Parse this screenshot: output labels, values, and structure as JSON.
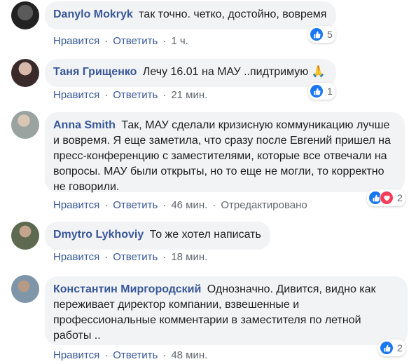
{
  "colors": {
    "link": "#385898",
    "bubble": "#f2f3f5",
    "meta": "#606770",
    "like": "#1877f2",
    "love": "#f33e58"
  },
  "comments": [
    {
      "author": "Danylo Mokryk",
      "text": "так точно. четко, достойно, вовремя",
      "like_label": "Нравится",
      "reply_label": "Ответить",
      "time": "1 ч.",
      "reactions": [
        "like-icon"
      ],
      "reaction_count": "5"
    },
    {
      "author": "Таня Грищенко",
      "text": "Лечу 16.01 на МАУ ..пидтримую 🙏",
      "like_label": "Нравится",
      "reply_label": "Ответить",
      "time": "21 мин.",
      "reactions": [
        "like-icon"
      ],
      "reaction_count": "1"
    },
    {
      "author": "Anna Smith",
      "text": "Так, МАУ сделали кризисную коммуникацию лучше и вовремя. Я еще заметила, что сразу после Евгений пришел на пресс-конференцию с заместителями, которые все отвечали на вопросы. МАУ были открыты, но то еще не могли, то корректно не говорили.",
      "like_label": "Нравится",
      "reply_label": "Ответить",
      "time": "46 мин.",
      "edited": "Отредактировано",
      "reactions": [
        "like-icon",
        "love-icon"
      ],
      "reaction_count": "2"
    },
    {
      "author": "Dmytro Lykhoviy",
      "text": "То же хотел написать",
      "like_label": "Нравится",
      "reply_label": "Ответить",
      "time": "18 мин."
    },
    {
      "author": "Константин Миргородский",
      "text": "Однозначно. Дивится, видно как переживает директор компании, взвешенные и профессиональные комментарии в заместителя по летной работы ..",
      "like_label": "Нравится",
      "reply_label": "Ответить",
      "time": "48 мин.",
      "reactions": [
        "like-icon"
      ],
      "reaction_count": "2"
    }
  ]
}
